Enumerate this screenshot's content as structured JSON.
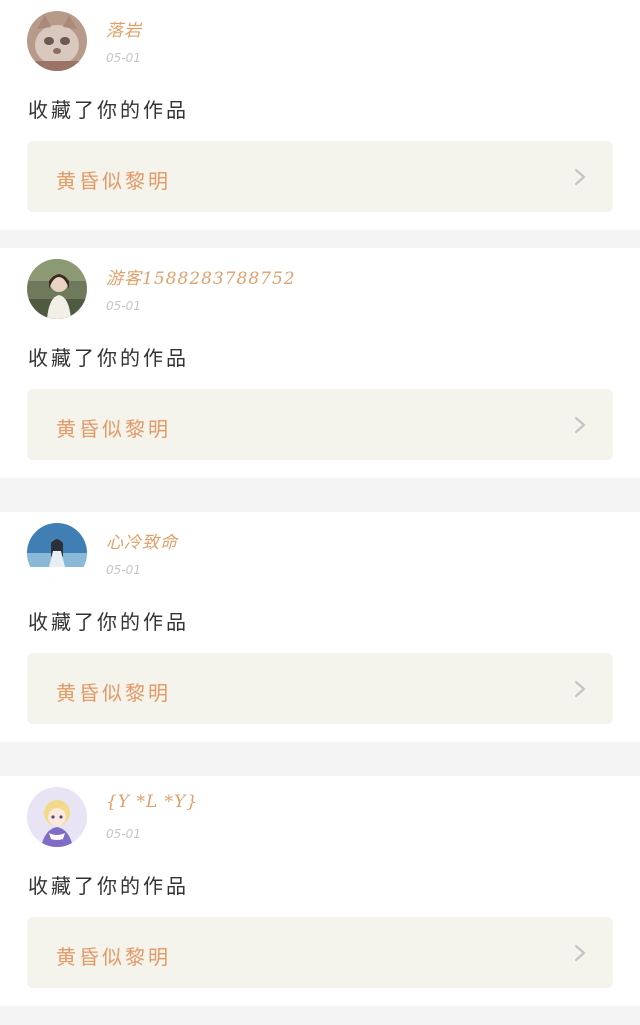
{
  "colors": {
    "background": "#f4f4f4",
    "card": "#ffffff",
    "username": "#e0a06a",
    "date": "#c6c6c6",
    "action_text": "#333333",
    "work_box": "#f4f3ec",
    "work_title": "#e39a66",
    "chevron": "#c4c4c4"
  },
  "notifications": [
    {
      "avatar_icon": "cat-photo-avatar-icon",
      "username": "落岩",
      "date": "05-01",
      "action": "收藏了你的作品",
      "work_title": "黄昏似黎明",
      "chevron_icon": "chevron-right-icon"
    },
    {
      "avatar_icon": "person-photo-avatar-icon",
      "username": "游客1588283788752",
      "date": "05-01",
      "action": "收藏了你的作品",
      "work_title": "黄昏似黎明",
      "chevron_icon": "chevron-right-icon"
    },
    {
      "avatar_icon": "anime-figure-avatar-icon",
      "username": "心冷致命",
      "date": "05-01",
      "action": "收藏了你的作品",
      "work_title": "黄昏似黎明",
      "chevron_icon": "chevron-right-icon"
    },
    {
      "avatar_icon": "anime-girl-avatar-icon",
      "username": "{Y *L *Y}",
      "date": "05-01",
      "action": "收藏了你的作品",
      "work_title": "黄昏似黎明",
      "chevron_icon": "chevron-right-icon"
    }
  ]
}
